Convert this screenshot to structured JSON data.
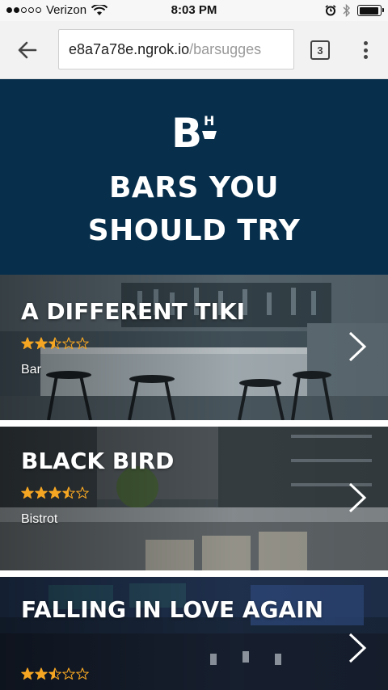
{
  "status_bar": {
    "carrier": "Verizon",
    "time": "8:03 PM",
    "signal_bars_filled": 2,
    "signal_bars_total": 5,
    "battery_level": 0.95
  },
  "browser": {
    "url_host": "e8a7a78e.ngrok.io",
    "url_path": "/barsugges",
    "tab_count": "3"
  },
  "header": {
    "logo_letter": "B",
    "logo_small_letter": "H",
    "title": "BARS YOU\nSHOULD TRY",
    "background": "#072f4c"
  },
  "bars": [
    {
      "name": "A DIFFERENT TIKI",
      "type": "Bar",
      "rating": 2.5,
      "max_rating": 5
    },
    {
      "name": "BLACK BIRD",
      "type": "Bistrot",
      "rating": 3.5,
      "max_rating": 5
    },
    {
      "name": "FALLING IN LOVE AGAIN",
      "type": "",
      "rating": 2.5,
      "max_rating": 5
    }
  ],
  "colors": {
    "star": "#f5a623",
    "header_bg": "#072f4c"
  }
}
